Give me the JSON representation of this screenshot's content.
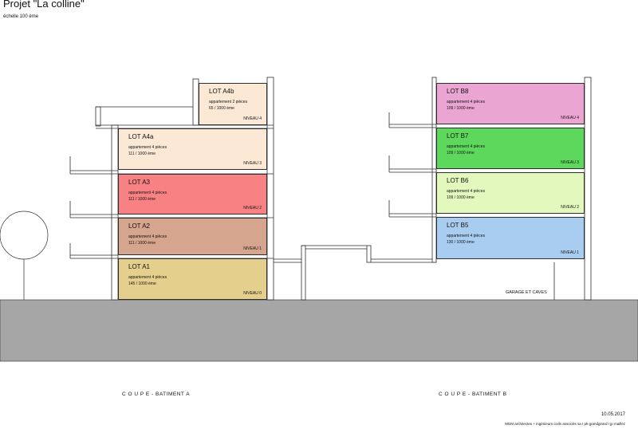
{
  "header": {
    "title": "Projet \"La colline\"",
    "scale": "échelle 100 ème"
  },
  "lots": [
    {
      "name": "LOT A4b",
      "type": "appartement 2 pièces",
      "share": "65 / 1000 ème",
      "level": "NIVEAU  4",
      "color": "#fbe9d6"
    },
    {
      "name": "LOT A4a",
      "type": "appartement 4 pièces",
      "share": "111 / 1000 ème",
      "level": "NIVEAU  3",
      "color": "#fbe9d6"
    },
    {
      "name": "LOT A3",
      "type": "appartement 4 pièces",
      "share": "111 / 1000 ème",
      "level": "NIVEAU  2",
      "color": "#f88184"
    },
    {
      "name": "LOT A2",
      "type": "appartement 4 pièces",
      "share": "111 / 1000 ème",
      "level": "NIVEAU  1",
      "color": "#d6a58d"
    },
    {
      "name": "LOT A1",
      "type": "appartement 4 pièces",
      "share": "145 / 1000 ème",
      "level": "NIVEAU  0",
      "color": "#e5cf8c"
    },
    {
      "name": "LOT B8",
      "type": "appartement 4 pièces",
      "share": "109 / 1000 ème",
      "level": "NIVEAU  4",
      "color": "#eba5d2"
    },
    {
      "name": "LOT B7",
      "type": "appartement 4 pièces",
      "share": "109 / 1000 ème",
      "level": "NIVEAU  3",
      "color": "#5dd85d"
    },
    {
      "name": "LOT B6",
      "type": "appartement 4 pièces",
      "share": "109 / 1000 ème",
      "level": "NIVEAU  2",
      "color": "#e2f8bd"
    },
    {
      "name": "LOT B5",
      "type": "appartement 4 pièces",
      "share": "130 / 1000 ème",
      "level": "NIVEAU  1",
      "color": "#a9cdf1"
    }
  ],
  "labels": {
    "garage": "GARAGE ET CAVES",
    "section_a": "C O U P E  -   BATIMENT A",
    "section_b": "C O U P E  -   BATIMENT B"
  },
  "footer": {
    "date": "10.05.2017",
    "credits": "MGM architectes + ingénieurs civils associés sa   I   pk grandgirard   I   jp maillez"
  },
  "colors": {
    "ground": "#a6a6a6",
    "line": "#2d2d2d"
  }
}
